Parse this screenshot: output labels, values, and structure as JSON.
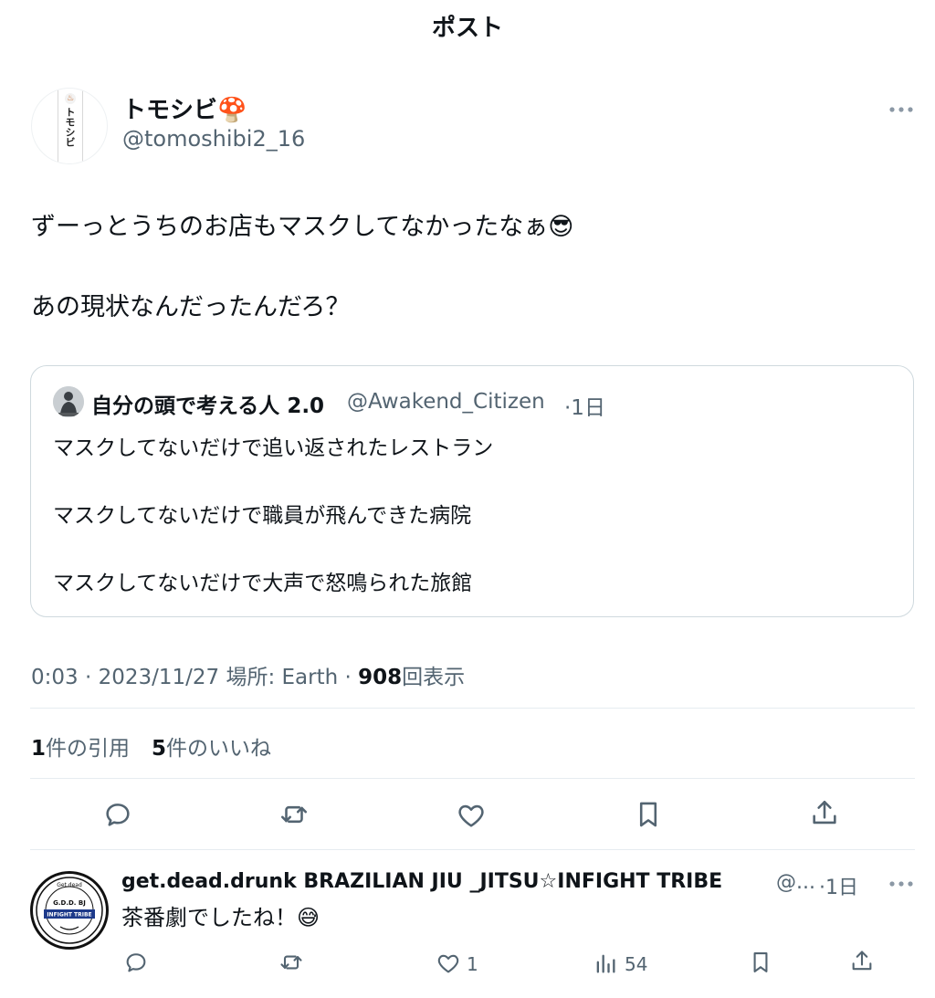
{
  "header": {
    "title": "ポスト"
  },
  "post": {
    "author_name": "トモシビ🍄",
    "author_handle": "@tomoshibi2_16",
    "avatar_text": "トモシビ",
    "more_icon": "more-horizontal-icon",
    "text_line1": "ずーっとうちのお店もマスクしてなかったなぁ😎",
    "text_line2": "あの現状なんだったんだろ？",
    "quote": {
      "author_name": "自分の頭で考える人 2.0",
      "author_handle": "@Awakend_Citizen",
      "time": "·1日",
      "line1": "マスクしてないだけで追い返されたレストラン",
      "line2": "マスクしてないだけで職員が飛んできた病院",
      "line3": "マスクしてないだけで大声で怒鳴られた旅館"
    },
    "meta": {
      "time": "0:03 · 2023/11/27",
      "location": "場所: Earth ·",
      "views_count": "908",
      "views_label": "回表示"
    },
    "stats": {
      "quotes_count": "1",
      "quotes_label": "件の引用",
      "likes_count": "5",
      "likes_label": "件のいいね"
    },
    "actions": [
      "reply-icon",
      "retweet-icon",
      "like-icon",
      "bookmark-icon",
      "share-icon"
    ]
  },
  "reply": {
    "author_name": "get.dead.drunk BRAZILIAN JIU _JITSU☆INFIGHT TRIBE",
    "author_handle": "@...",
    "time": "·1日",
    "text": "茶番劇でしたね！😅",
    "like_count": "1",
    "view_count": "54",
    "avatar_top": "Get.dead",
    "avatar_mid": "G.D.D. BJ",
    "avatar_band": "INFIGHT TRIBE"
  }
}
